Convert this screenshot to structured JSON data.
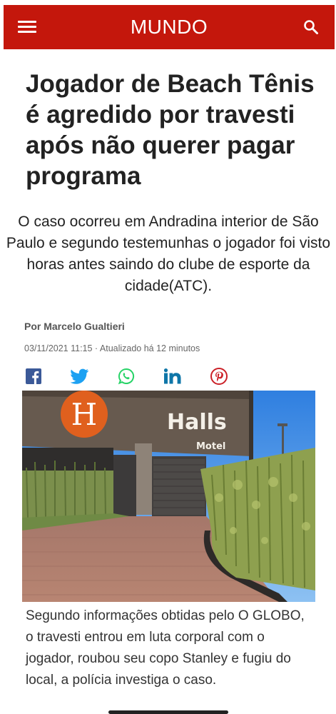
{
  "header": {
    "section": "MUNDO",
    "menu_icon": "hamburger-menu-icon",
    "search_icon": "search-icon",
    "background_color": "#c4170c"
  },
  "article": {
    "headline": "Jogador de Beach Tênis é agredido por travesti após não querer pagar programa",
    "subtitle": "O caso ocorreu em Andradina interior de São Paulo e segundo testemunhas o jogador foi visto horas antes saindo do clube de esporte da cidade(ATC).",
    "author": "Por Marcelo Gualtieri",
    "published": "03/11/2021 11:15 · Atualizado há 12 minutos"
  },
  "share": {
    "icons": [
      "facebook-icon",
      "twitter-icon",
      "whatsapp-icon",
      "linkedin-icon",
      "pinterest-icon"
    ],
    "colors": {
      "facebook": "#3b5998",
      "twitter": "#1da1f2",
      "whatsapp": "#25d366",
      "linkedin": "#0e76a8",
      "pinterest": "#cb2027"
    }
  },
  "photo": {
    "sign_letter": "H",
    "sign_name": "Halls",
    "sign_sub": "Motel"
  },
  "caption": "Segundo informações obtidas pelo O GLOBO, o travesti entrou em luta corporal com o jogador, roubou seu copo Stanley e fugiu do local, a polícia investiga o caso."
}
